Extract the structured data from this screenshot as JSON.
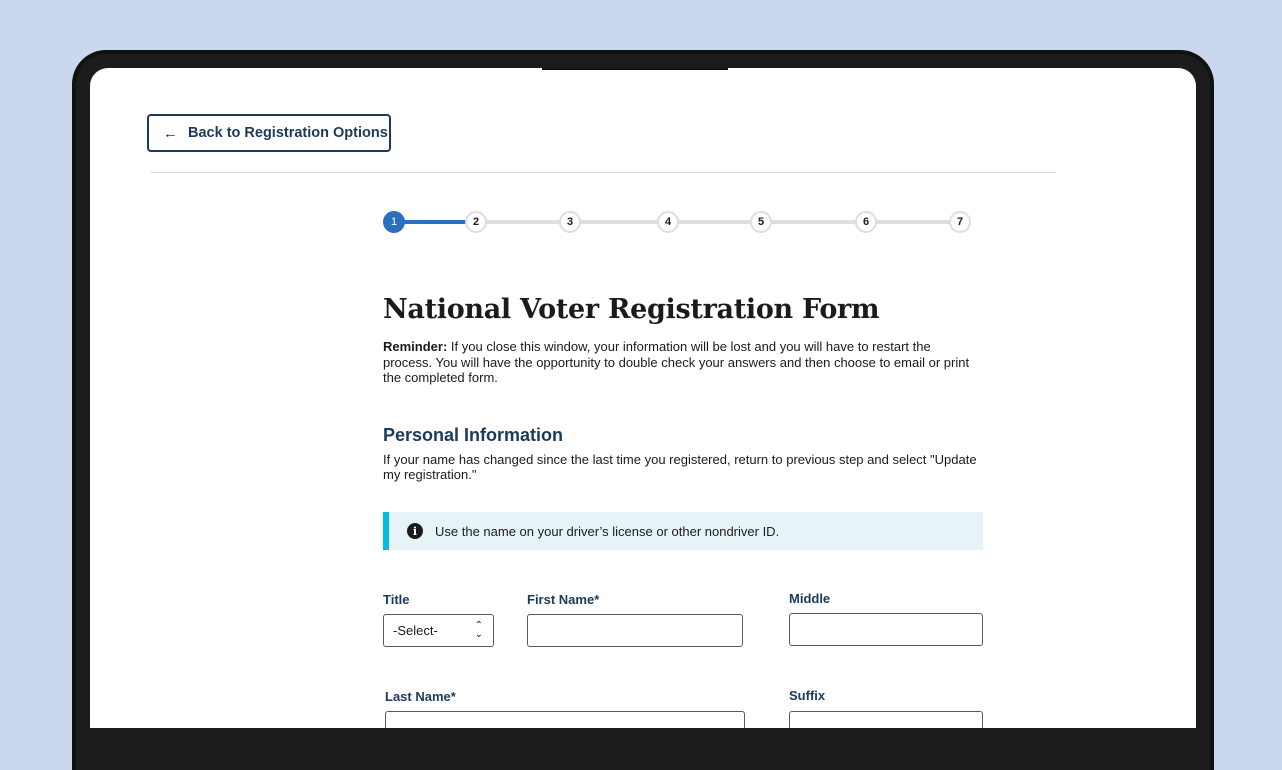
{
  "back_button": {
    "label": "Back to Registration Options",
    "icon": "arrow-left-icon"
  },
  "stepper": {
    "current_step": 1,
    "steps": [
      "1",
      "2",
      "3",
      "4",
      "5",
      "6",
      "7"
    ]
  },
  "page": {
    "title": "National Voter Registration Form",
    "reminder_label": "Reminder:",
    "reminder_text": "If you close this window, your information will be lost and you will have to restart the process. You will have the opportunity to double check your answers and then choose to email or print the completed form."
  },
  "personal_info": {
    "title": "Personal Information",
    "description": "If your name has changed since the last time you registered, return to previous step and select \"Update my registration.\"",
    "alert_text": "Use the name on your driver’s license or other nondriver ID.",
    "alert_icon": "info-icon"
  },
  "form": {
    "title_label": "Title",
    "title_selected": "-Select-",
    "first_name_label": "First Name*",
    "first_name_value": "",
    "middle_label": "Middle",
    "middle_value": "",
    "last_name_label": "Last Name*",
    "last_name_value": "",
    "suffix_label": "Suffix",
    "suffix_value": ""
  },
  "colors": {
    "background": "#c9d8ec",
    "primary_dark": "#1b3a5c",
    "step_active": "#2a6fc0",
    "alert_bg": "#e6f4f8",
    "alert_accent": "#00bde3"
  }
}
